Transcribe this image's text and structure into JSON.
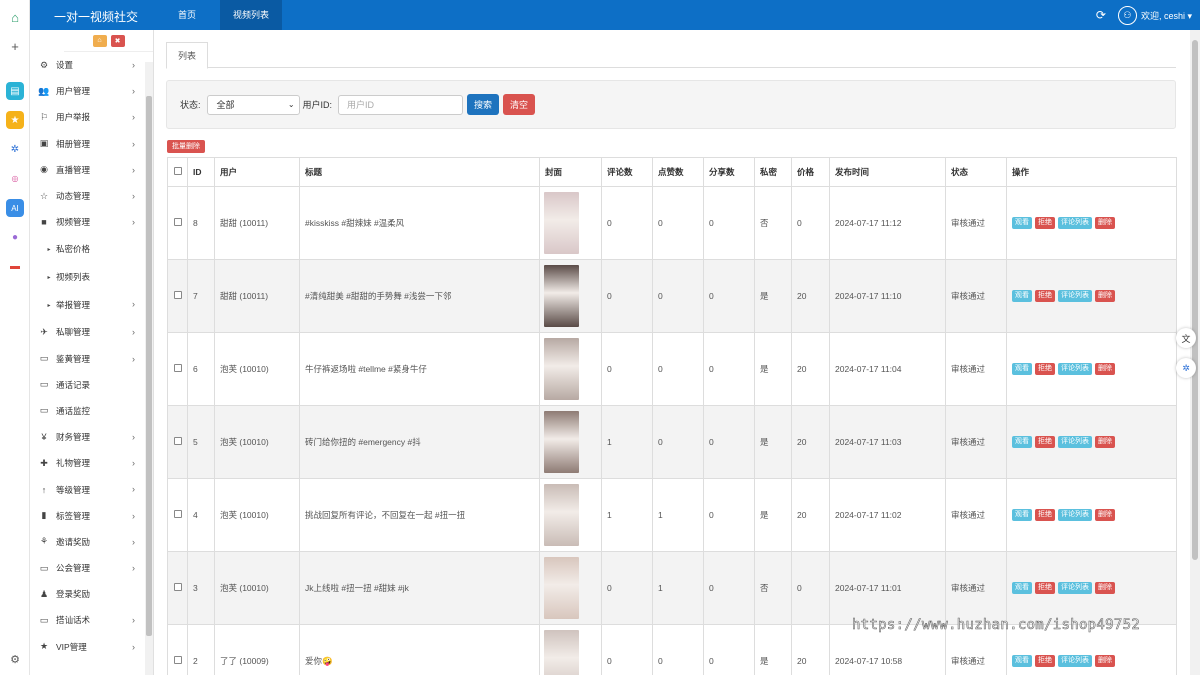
{
  "app": {
    "brand": "一对一视频社交"
  },
  "topnav": [
    {
      "label": "首页"
    },
    {
      "label": "视频列表"
    }
  ],
  "user": {
    "welcome": "欢迎, ceshi ▾"
  },
  "sidebar": {
    "items": [
      {
        "label": "设置",
        "icon": "⚙",
        "chevron": true
      },
      {
        "label": "用户管理",
        "icon": "👥",
        "chevron": true
      },
      {
        "label": "用户举报",
        "icon": "⚐",
        "chevron": true
      },
      {
        "label": "相册管理",
        "icon": "▣",
        "chevron": true
      },
      {
        "label": "直播管理",
        "icon": "◉",
        "chevron": true
      },
      {
        "label": "动态管理",
        "icon": "☆",
        "chevron": true
      },
      {
        "label": "视频管理",
        "icon": "■",
        "chevron": true,
        "open": true
      },
      {
        "label": "私密价格",
        "sub": true
      },
      {
        "label": "视频列表",
        "sub": true
      },
      {
        "label": "举报管理",
        "sub": true,
        "chevron": true
      },
      {
        "label": "私聊管理",
        "icon": "✈",
        "chevron": true
      },
      {
        "label": "鉴黄管理",
        "icon": "▭",
        "chevron": true
      },
      {
        "label": "通话记录",
        "icon": "▭",
        "chevron": false
      },
      {
        "label": "通话监控",
        "icon": "▭",
        "chevron": false
      },
      {
        "label": "财务管理",
        "icon": "¥",
        "chevron": true
      },
      {
        "label": "礼物管理",
        "icon": "✚",
        "chevron": true
      },
      {
        "label": "等级管理",
        "icon": "↑",
        "chevron": true
      },
      {
        "label": "标签管理",
        "icon": "▮",
        "chevron": true
      },
      {
        "label": "邀请奖励",
        "icon": "⚘",
        "chevron": true
      },
      {
        "label": "公会管理",
        "icon": "▭",
        "chevron": true
      },
      {
        "label": "登录奖励",
        "icon": "♟",
        "chevron": false
      },
      {
        "label": "搭讪话术",
        "icon": "▭",
        "chevron": true
      },
      {
        "label": "VIP管理",
        "icon": "★",
        "chevron": true
      }
    ]
  },
  "tabs": [
    {
      "label": "列表"
    }
  ],
  "filter": {
    "status_label": "状态:",
    "status_value": "全部",
    "uid_label": "用户ID:",
    "uid_placeholder": "用户ID",
    "search_label": "搜索",
    "clear_label": "清空"
  },
  "batch_delete": "批量删除",
  "table": {
    "headers": [
      "",
      "ID",
      "用户",
      "标题",
      "封面",
      "评论数",
      "点赞数",
      "分享数",
      "私密",
      "价格",
      "发布时间",
      "状态",
      "操作"
    ],
    "actions": {
      "view": "观看",
      "reject": "拒绝",
      "comments": "评论列表",
      "delete": "删除"
    },
    "rows": [
      {
        "id": "8",
        "user": "甜甜 (10011)",
        "title": "#kisskiss #甜辣妹 #温柔风",
        "comments": "0",
        "likes": "0",
        "shares": "0",
        "private": "否",
        "price": "0",
        "time": "2024-07-17 11:12",
        "status": "审核通过",
        "cover_color": "#d9c7c8"
      },
      {
        "id": "7",
        "user": "甜甜 (10011)",
        "title": "#清纯甜美 #甜甜的手势舞 #浅尝一下邻",
        "comments": "0",
        "likes": "0",
        "shares": "0",
        "private": "是",
        "price": "20",
        "time": "2024-07-17 11:10",
        "status": "审核通过",
        "cover_color": "#5a4b47"
      },
      {
        "id": "6",
        "user": "泡芙 (10010)",
        "title": "牛仔裤返场啦 #tellme #紧身牛仔",
        "comments": "0",
        "likes": "0",
        "shares": "0",
        "private": "是",
        "price": "20",
        "time": "2024-07-17 11:04",
        "status": "审核通过",
        "cover_color": "#b7a9a3"
      },
      {
        "id": "5",
        "user": "泡芙 (10010)",
        "title": "砖门给你扭的 #emergency #抖",
        "comments": "1",
        "likes": "0",
        "shares": "0",
        "private": "是",
        "price": "20",
        "time": "2024-07-17 11:03",
        "status": "审核通过",
        "cover_color": "#8e7b74"
      },
      {
        "id": "4",
        "user": "泡芙 (10010)",
        "title": "挑战回复所有评论，不回复在一起 #扭一扭",
        "comments": "1",
        "likes": "1",
        "shares": "0",
        "private": "是",
        "price": "20",
        "time": "2024-07-17 11:02",
        "status": "审核通过",
        "cover_color": "#c9bcb6"
      },
      {
        "id": "3",
        "user": "泡芙 (10010)",
        "title": "Jk上线啦 #扭一扭 #甜妹 #jk",
        "comments": "0",
        "likes": "1",
        "shares": "0",
        "private": "否",
        "price": "0",
        "time": "2024-07-17 11:01",
        "status": "审核通过",
        "cover_color": "#d8c6bd"
      },
      {
        "id": "2",
        "user": "了了 (10009)",
        "title": "爱你🤪",
        "comments": "0",
        "likes": "0",
        "shares": "0",
        "private": "是",
        "price": "20",
        "time": "2024-07-17 10:58",
        "status": "审核通过",
        "cover_color": "#cfc3be"
      }
    ]
  },
  "watermark": "https://www.huzhan.com/ishop49752"
}
